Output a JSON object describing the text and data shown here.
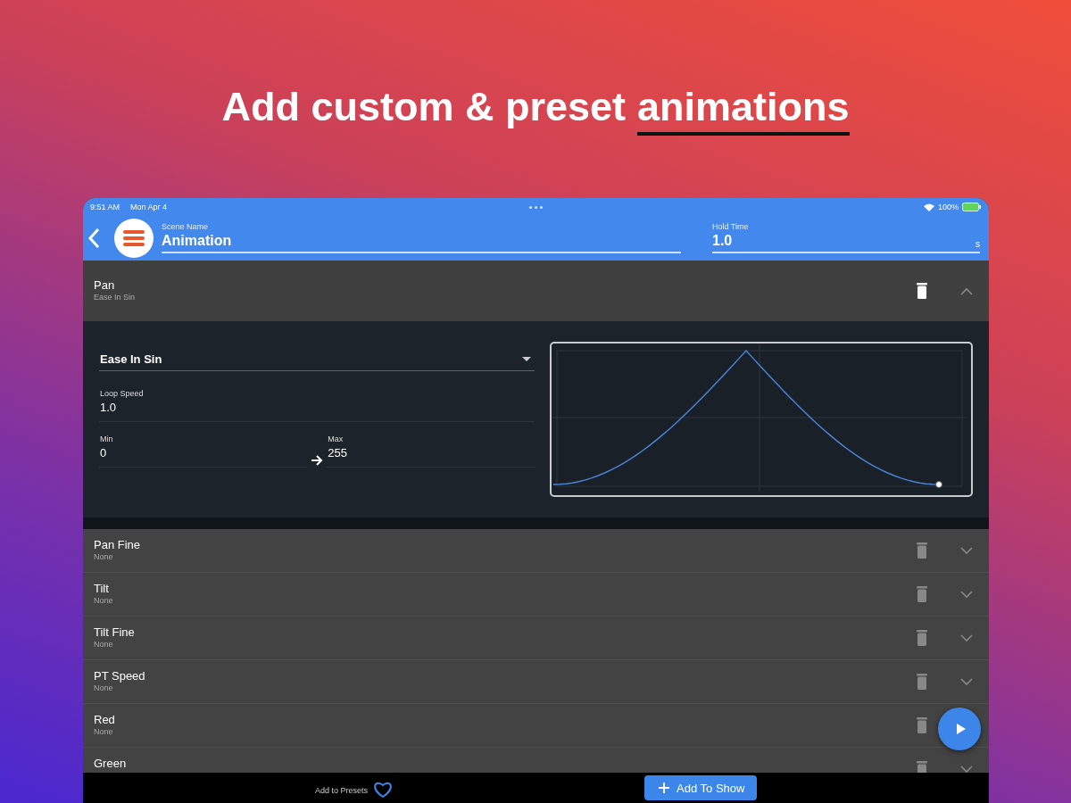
{
  "headline": {
    "text": "Add custom & preset",
    "underlined": "animations"
  },
  "status_bar": {
    "time": "9:51 AM",
    "date": "Mon Apr 4",
    "battery": "100%"
  },
  "header": {
    "scene_name": {
      "label": "Scene Name",
      "value": "Animation"
    },
    "hold_time": {
      "label": "Hold Time",
      "value": "1.0",
      "unit": "s"
    }
  },
  "channels": [
    {
      "name": "Pan",
      "effect": "Ease In Sin",
      "expanded": true,
      "editor": {
        "curve": "Ease In Sin",
        "loop_speed": {
          "label": "Loop Speed",
          "value": "1.0"
        },
        "min": {
          "label": "Min",
          "value": "0"
        },
        "max": {
          "label": "Max",
          "value": "255"
        }
      }
    },
    {
      "name": "Pan Fine",
      "effect": "None",
      "expanded": false
    },
    {
      "name": "Tilt",
      "effect": "None",
      "expanded": false
    },
    {
      "name": "Tilt Fine",
      "effect": "None",
      "expanded": false
    },
    {
      "name": "PT Speed",
      "effect": "None",
      "expanded": false
    },
    {
      "name": "Red",
      "effect": "None",
      "expanded": false,
      "play_button": true
    },
    {
      "name": "Green",
      "expanded": false
    }
  ],
  "footer": {
    "presets_label": "Add to Presets",
    "add_button": "Add To Show"
  }
}
